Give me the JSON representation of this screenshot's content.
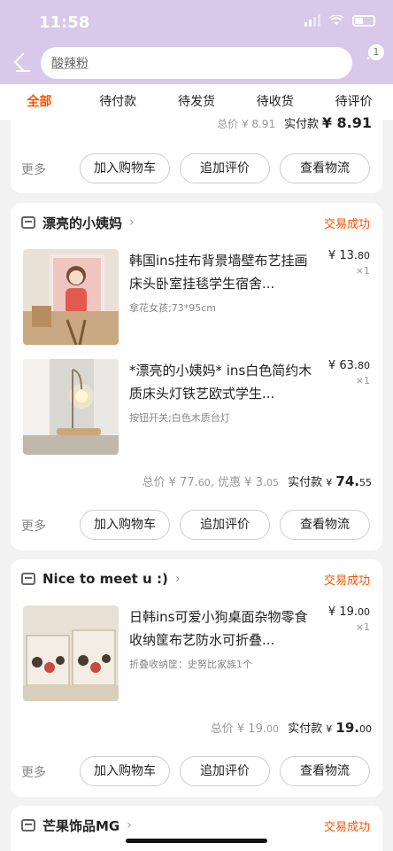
{
  "status_bar": {
    "time": "11:58"
  },
  "search": {
    "value": "酸辣粉",
    "badge": "1"
  },
  "tabs": [
    "全部",
    "待付款",
    "待发货",
    "待收货",
    "待评价"
  ],
  "prev_order": {
    "total_label": "总价",
    "total": "¥ 8.91",
    "actual_label": "实付款",
    "actual": "¥ 8.91"
  },
  "actions": {
    "more": "更多",
    "add_cart": "加入购物车",
    "add_review": "追加评价",
    "logistics": "查看物流"
  },
  "orders": [
    {
      "shop": "漂亮的小姨妈",
      "status": "交易成功",
      "items": [
        {
          "title": "韩国ins挂布背景墙壁布艺挂画床头卧室挂毯学生宿舍...",
          "spec": "拿花女孩;73*95cm",
          "price_int": "¥ 13.",
          "price_dec": "80",
          "qty": "×1"
        },
        {
          "title": "*漂亮的小姨妈* ins白色简约木质床头灯铁艺欧式学生...",
          "spec": "按钮开关;白色木质台灯",
          "price_int": "¥ 63.",
          "price_dec": "80",
          "qty": "×1"
        }
      ],
      "total_label": "总价",
      "total_int": "¥ 77.",
      "total_dec": "60",
      "discount_label": "优惠",
      "discount_int": "¥ 3.",
      "discount_dec": "05",
      "actual_label": "实付款",
      "actual_cur": "¥",
      "actual_int": "74.",
      "actual_dec": "55"
    },
    {
      "shop": "Nice to meet u :)",
      "status": "交易成功",
      "items": [
        {
          "title": "日韩ins可爱小狗桌面杂物零食收纳筐布艺防水可折叠...",
          "spec": "折叠收纳筐：史努比家族1个",
          "price_int": "¥ 19.",
          "price_dec": "00",
          "qty": "×1"
        }
      ],
      "total_label": "总价",
      "total_int": "¥ 19.",
      "total_dec": "00",
      "actual_label": "实付款",
      "actual_cur": "¥",
      "actual_int": "19.",
      "actual_dec": "00"
    },
    {
      "shop": "芒果饰品MG",
      "status": "交易成功"
    }
  ]
}
